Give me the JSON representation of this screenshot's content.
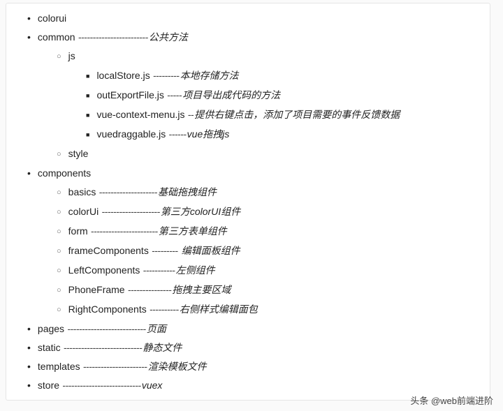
{
  "tree": [
    {
      "name": "colorui",
      "sep": "",
      "desc": ""
    },
    {
      "name": "common",
      "sep": " ------------------------",
      "desc": "公共方法",
      "children": [
        {
          "name": "js",
          "sep": "",
          "desc": "",
          "children": [
            {
              "name": "localStore.js",
              "sep": " ---------",
              "desc": "本地存储方法"
            },
            {
              "name": "outExportFile.js",
              "sep": " -----",
              "desc": "项目导出成代码的方法"
            },
            {
              "name": "vue-context-menu.js",
              "sep": " --",
              "desc": "提供右键点击，添加了项目需要的事件反馈数据"
            },
            {
              "name": "vuedraggable.js",
              "sep": " ------",
              "desc": "vue拖拽js"
            }
          ]
        },
        {
          "name": "style",
          "sep": "",
          "desc": ""
        }
      ]
    },
    {
      "name": "components",
      "sep": "",
      "desc": "",
      "children": [
        {
          "name": "basics",
          "sep": " --------------------",
          "desc": "基础拖拽组件"
        },
        {
          "name": "colorUi",
          "sep": " --------------------",
          "desc": "第三方colorUI组件"
        },
        {
          "name": "form",
          "sep": " -----------------------",
          "desc": "第三方表单组件"
        },
        {
          "name": "frameComponents",
          "sep": " ---------",
          "desc": " 编辑面板组件"
        },
        {
          "name": "LeftComponents",
          "sep": " -----------",
          "desc": "左侧组件"
        },
        {
          "name": "PhoneFrame",
          "sep": " ---------------",
          "desc": "拖拽主要区域"
        },
        {
          "name": "RightComponents",
          "sep": " ----------",
          "desc": "右侧样式编辑面包"
        }
      ]
    },
    {
      "name": "pages",
      "sep": " ---------------------------",
      "desc": "页面"
    },
    {
      "name": "static",
      "sep": " ---------------------------",
      "desc": "静态文件"
    },
    {
      "name": "templates",
      "sep": " ----------------------",
      "desc": "渲染模板文件"
    },
    {
      "name": "store",
      "sep": " ---------------------------",
      "desc": "vuex"
    }
  ],
  "footer": "头条 @web前端进阶"
}
